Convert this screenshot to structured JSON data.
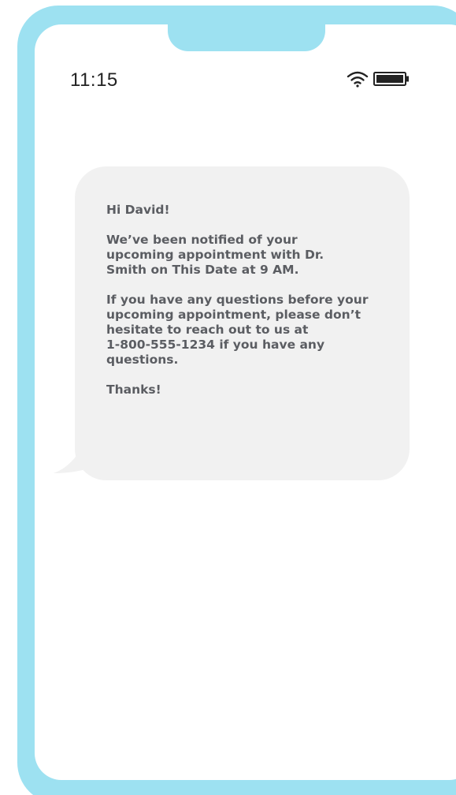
{
  "status_bar": {
    "time": "11:15",
    "icons": [
      "wifi-icon",
      "battery-icon"
    ]
  },
  "message": {
    "greeting": "Hi David!",
    "paragraph1_lines": [
      "We’ve been notified of your",
      "upcoming appointment with Dr.",
      "Smith on This Date at 9 AM."
    ],
    "paragraph2_lines": [
      "If you have any questions before your",
      "upcoming appointment, please don’t",
      "hesitate to reach out to us at",
      "1-800-555-1234 if you have any",
      "questions."
    ],
    "signoff": "Thanks!"
  },
  "colors": {
    "frame": "#9de1f1",
    "bubble": "#f1f1f1",
    "text": "#5b5d62"
  }
}
